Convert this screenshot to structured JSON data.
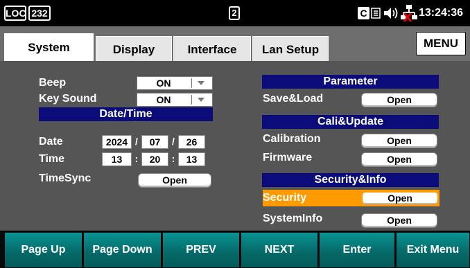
{
  "status": {
    "loc": "LOC",
    "rate": "232",
    "slot": "2",
    "time": "13:24:36"
  },
  "tabs": [
    "System",
    "Display",
    "Interface",
    "Lan Setup"
  ],
  "menu_label": "MENU",
  "left": {
    "beep_label": "Beep",
    "beep_value": "ON",
    "keysound_label": "Key Sound",
    "keysound_value": "ON",
    "datetime_header": "Date/Time",
    "date_label": "Date",
    "date": {
      "year": "2024",
      "month": "07",
      "day": "26",
      "sep": "/"
    },
    "time_label": "Time",
    "time": {
      "hour": "13",
      "minute": "20",
      "second": "13",
      "sep": ":"
    },
    "timesync_label": "TimeSync",
    "timesync_button": "Open"
  },
  "right": {
    "parameter_header": "Parameter",
    "saveload_label": "Save&Load",
    "saveload_button": "Open",
    "caliupdate_header": "Cali&Update",
    "calibration_label": "Calibration",
    "calibration_button": "Open",
    "firmware_label": "Firmware",
    "firmware_button": "Open",
    "securityinfo_header": "Security&Info",
    "security_label": "Security",
    "security_button": "Open",
    "systeminfo_label": "SystemInfo",
    "systeminfo_button": "Open"
  },
  "softkeys": [
    "Page Up",
    "Page Down",
    "PREV",
    "NEXT",
    "Enter",
    "Exit Menu"
  ],
  "colors": {
    "header": "#0b0b7a",
    "accent": "#ff9a00",
    "softkey": "#078080",
    "panel": "#555555"
  }
}
